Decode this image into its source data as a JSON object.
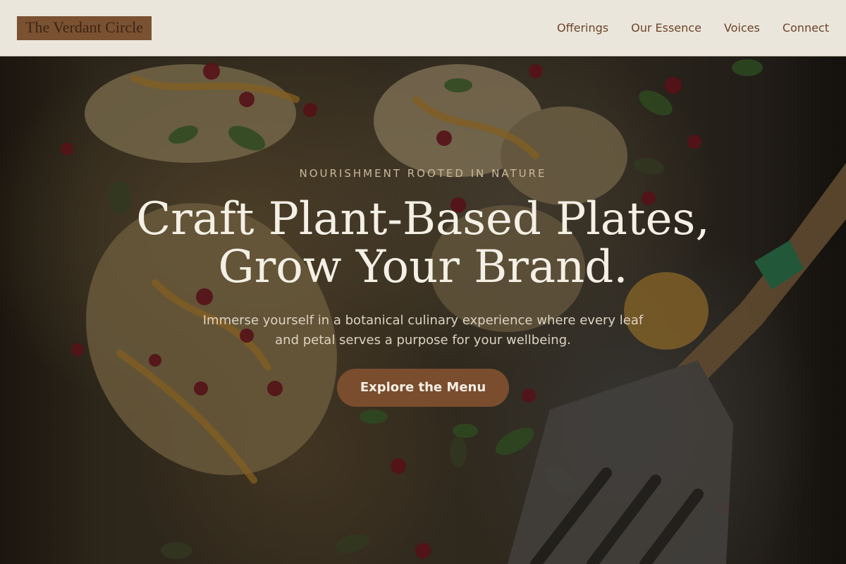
{
  "header": {
    "logo_text": "The Verdant Circle",
    "nav": [
      {
        "label": "Offerings"
      },
      {
        "label": "Our Essence"
      },
      {
        "label": "Voices"
      },
      {
        "label": "Connect"
      }
    ]
  },
  "hero": {
    "tagline": "NOURISHMENT ROOTED IN NATURE",
    "headline_line1": "Craft Plant-Based Plates,",
    "headline_line2": "Grow Your Brand.",
    "subheadline": "Immerse yourself in a botanical culinary experience where every leaf and petal serves a purpose for your wellbeing.",
    "cta_label": "Explore the Menu"
  },
  "colors": {
    "header_bg": "#ebe6dc",
    "brand_brown": "#7a4d2e",
    "nav_text": "#6b4429",
    "headline_text": "#f5f0e6"
  }
}
